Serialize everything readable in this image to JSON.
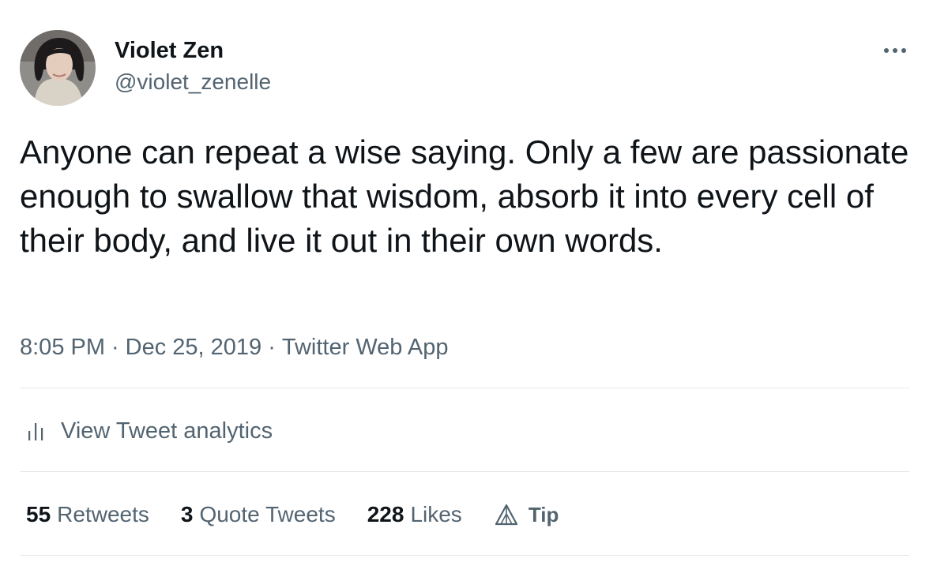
{
  "author": {
    "name": "Violet Zen",
    "handle": "@violet_zenelle"
  },
  "tweet": {
    "text": "Anyone can repeat a wise saying. Only a few are passionate enough to swallow that wisdom, absorb it into every cell of their body, and live it out in their own words."
  },
  "meta": {
    "time": "8:05 PM",
    "date": "Dec 25, 2019",
    "source": "Twitter Web App",
    "separator": "·"
  },
  "analytics": {
    "label": "View Tweet analytics",
    "icon": "bar-chart-icon"
  },
  "stats": {
    "retweets_count": "55",
    "retweets_label": "Retweets",
    "quotes_count": "3",
    "quotes_label": "Quote Tweets",
    "likes_count": "228",
    "likes_label": "Likes",
    "tip_label": "Tip",
    "tip_icon": "tip-triangle-icon"
  },
  "colors": {
    "text": "#0f1419",
    "secondary": "#536471",
    "divider": "#e3e7ea"
  }
}
